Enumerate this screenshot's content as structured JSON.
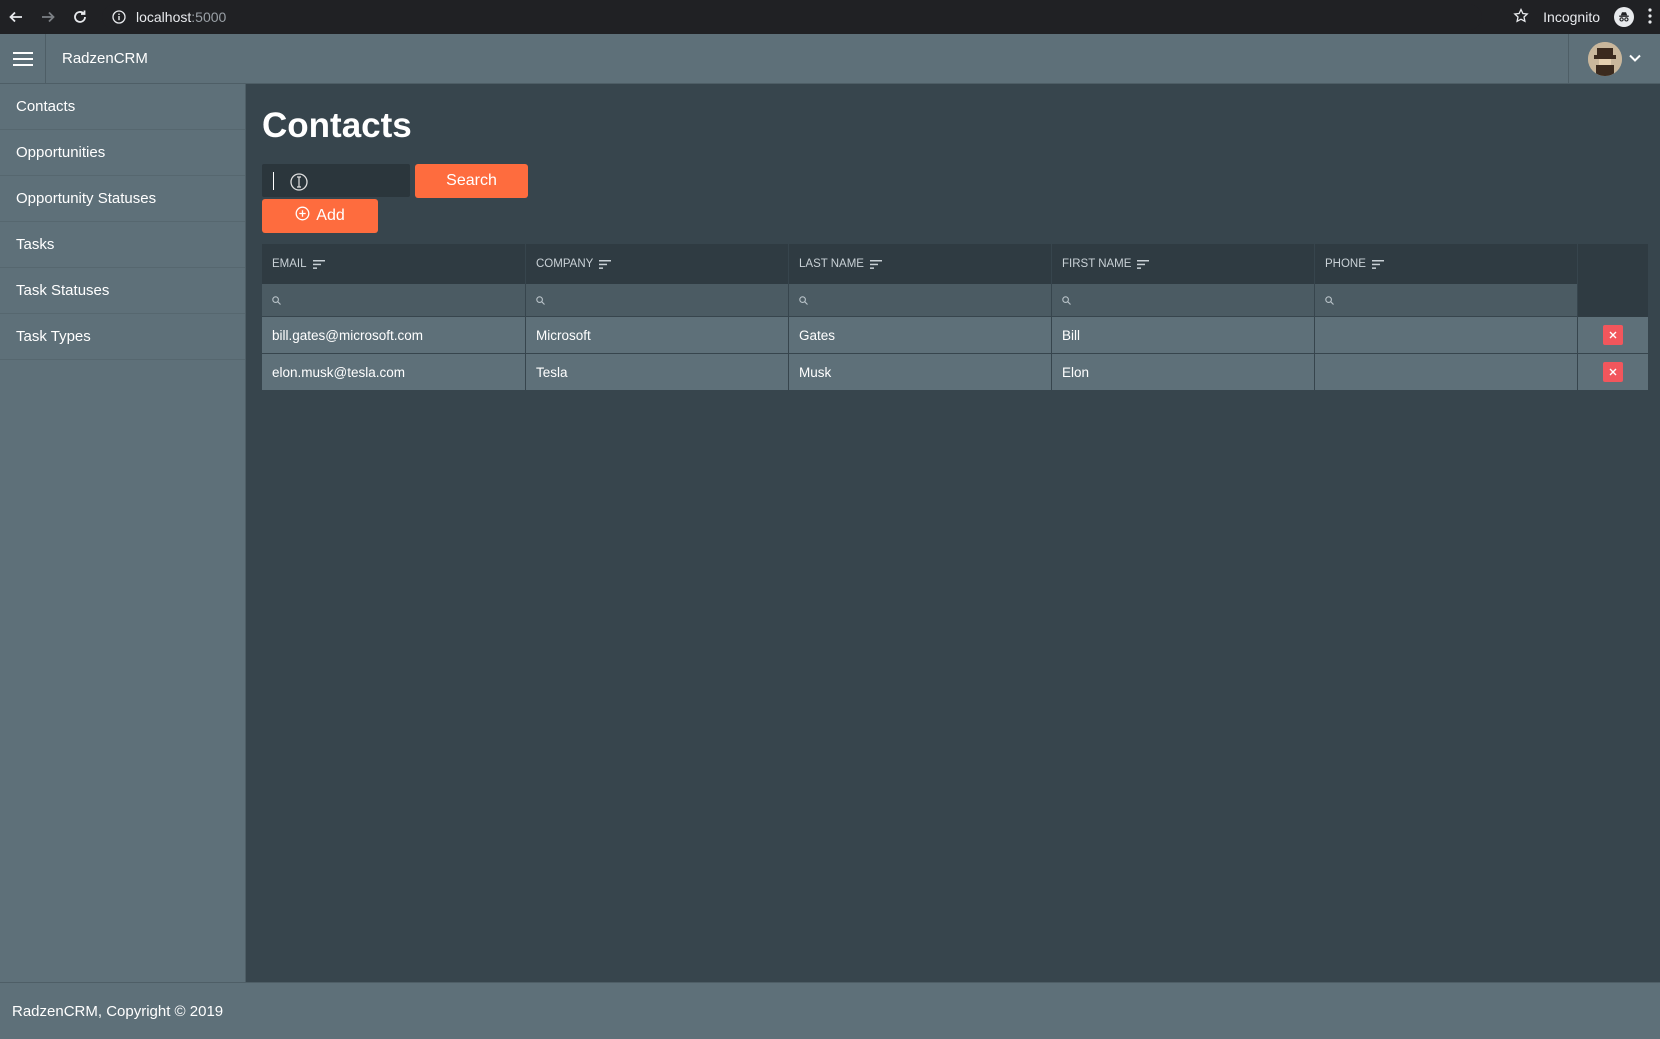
{
  "browser": {
    "url_host": "localhost",
    "url_port": ":5000",
    "incognito_label": "Incognito"
  },
  "header": {
    "app_title": "RadzenCRM"
  },
  "sidebar": {
    "items": [
      {
        "label": "Contacts"
      },
      {
        "label": "Opportunities"
      },
      {
        "label": "Opportunity Statuses"
      },
      {
        "label": "Tasks"
      },
      {
        "label": "Task Statuses"
      },
      {
        "label": "Task Types"
      }
    ]
  },
  "main": {
    "title": "Contacts",
    "search_value": "",
    "search_button": "Search",
    "add_button": "Add"
  },
  "grid": {
    "columns": [
      "EMAIL",
      "COMPANY",
      "LAST NAME",
      "FIRST NAME",
      "PHONE"
    ],
    "rows": [
      {
        "email": "bill.gates@microsoft.com",
        "company": "Microsoft",
        "last_name": "Gates",
        "first_name": "Bill",
        "phone": ""
      },
      {
        "email": "elon.musk@tesla.com",
        "company": "Tesla",
        "last_name": "Musk",
        "first_name": "Elon",
        "phone": ""
      }
    ]
  },
  "footer": {
    "text": "RadzenCRM, Copyright © 2019"
  },
  "colors": {
    "accent": "#fe6c3e",
    "danger": "#f2565c",
    "panel": "#5e7079",
    "background": "#37454d"
  }
}
